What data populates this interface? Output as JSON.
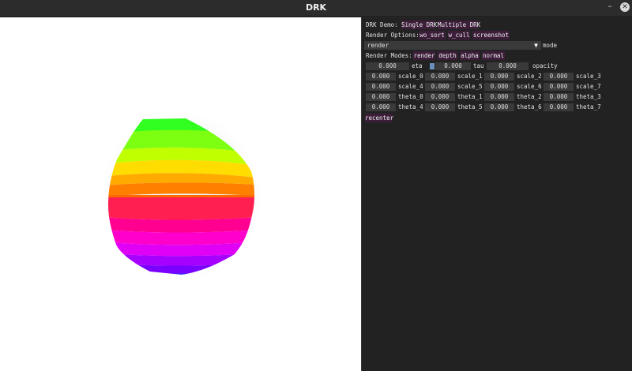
{
  "window": {
    "title": "DRK"
  },
  "panel": {
    "demo_label": "DRK Demo:",
    "single_drk": "Single DRK",
    "multiple_drk": "Multiple DRK",
    "render_options_label": "Render Options:",
    "wo_sort": "wo_sort",
    "w_cull": "w_cull",
    "screenshot": "screenshot",
    "mode_value": "render",
    "mode_label": "mode",
    "render_modes_label": "Render Modes:",
    "modes": [
      "render",
      "depth",
      "alpha",
      "normal"
    ],
    "params_row": [
      {
        "value": "0.000",
        "label": "eta"
      },
      {
        "value": "0.000",
        "label": "tau"
      },
      {
        "value": "0.000",
        "label": "opacity"
      }
    ],
    "grid": [
      [
        {
          "value": "0.000",
          "label": "scale_0"
        },
        {
          "value": "0.000",
          "label": "scale_1"
        },
        {
          "value": "0.000",
          "label": "scale_2"
        },
        {
          "value": "0.000",
          "label": "scale_3"
        }
      ],
      [
        {
          "value": "0.000",
          "label": "scale_4"
        },
        {
          "value": "0.000",
          "label": "scale_5"
        },
        {
          "value": "0.000",
          "label": "scale_6"
        },
        {
          "value": "0.000",
          "label": "scale_7"
        }
      ],
      [
        {
          "value": "0.000",
          "label": "theta_0"
        },
        {
          "value": "0.000",
          "label": "theta_1"
        },
        {
          "value": "0.000",
          "label": "theta_2"
        },
        {
          "value": "0.000",
          "label": "theta_3"
        }
      ],
      [
        {
          "value": "0.000",
          "label": "theta_4"
        },
        {
          "value": "0.000",
          "label": "theta_5"
        },
        {
          "value": "0.000",
          "label": "theta_6"
        },
        {
          "value": "0.000",
          "label": "theta_7"
        }
      ]
    ],
    "recenter": "recenter"
  },
  "colors": {
    "button_bg": "#3d1e3a",
    "field_bg": "#3a3a3a",
    "panel_bg": "#222222",
    "accent": "#3d6a9c"
  }
}
